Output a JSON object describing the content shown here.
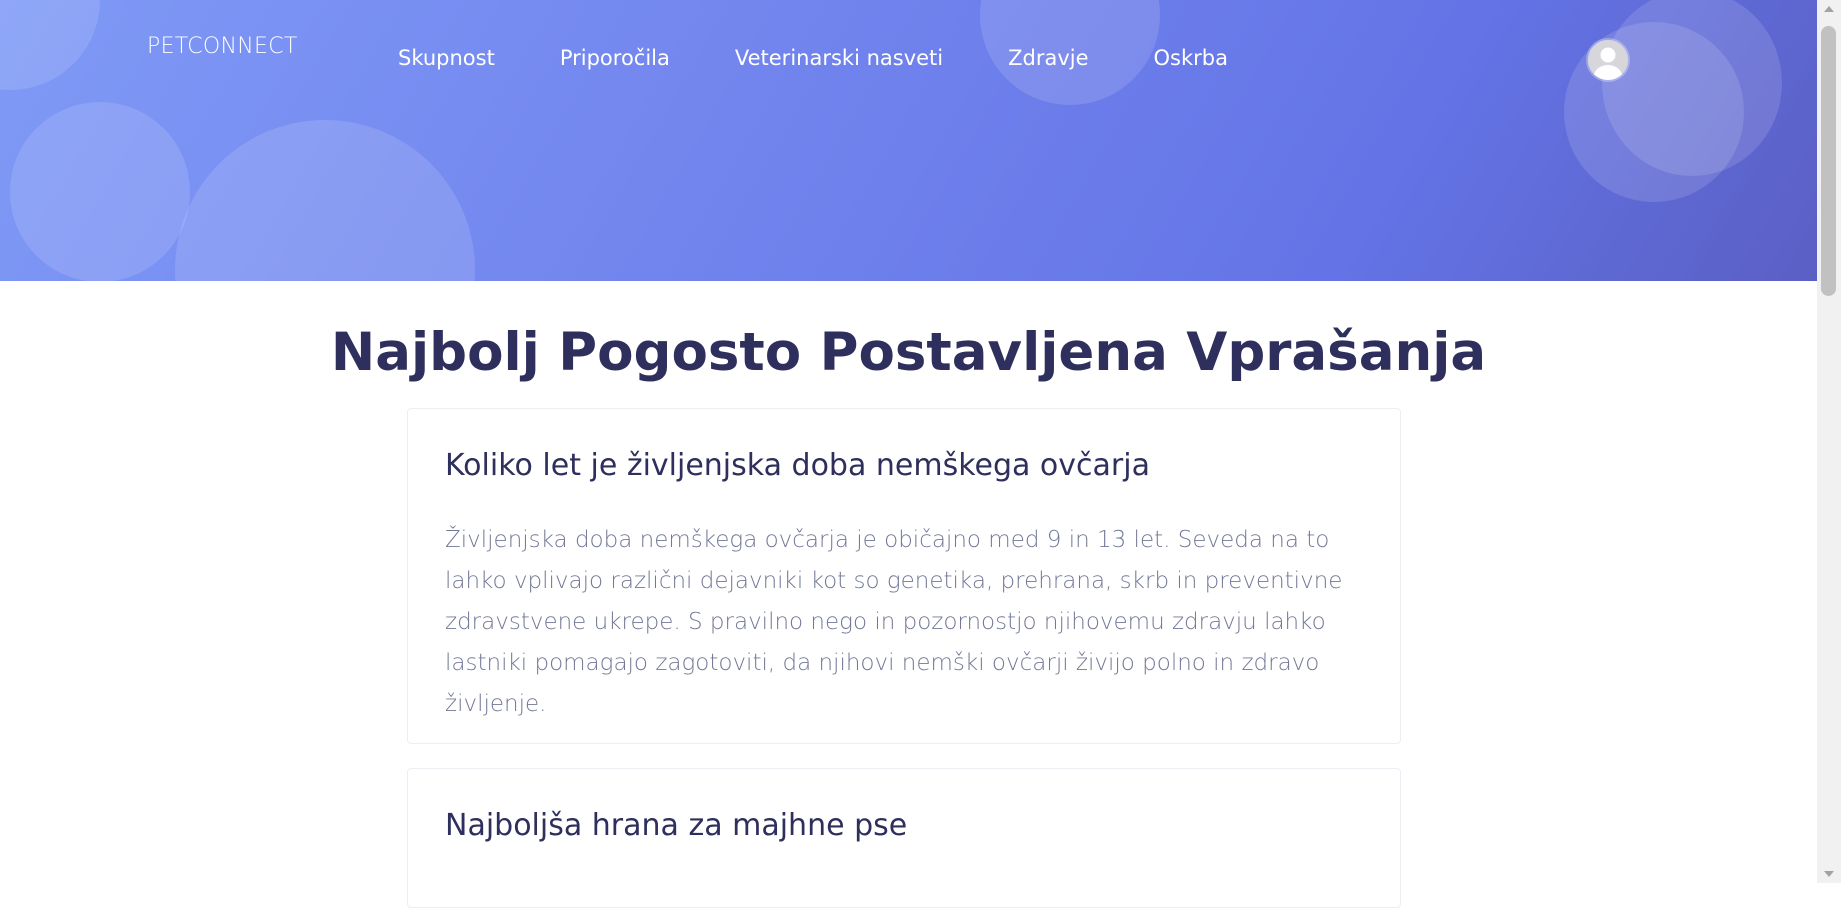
{
  "header": {
    "brand": "PETCONNECT",
    "nav": [
      {
        "label": "Skupnost"
      },
      {
        "label": "Priporočila"
      },
      {
        "label": "Veterinarski nasveti"
      },
      {
        "label": "Zdravje"
      },
      {
        "label": "Oskrba"
      }
    ],
    "avatar_icon": "user-avatar-icon"
  },
  "main": {
    "title": "Najbolj Pogosto Postavljena Vprašanja",
    "faqs": [
      {
        "question": "Koliko let je življenjska doba nemškega ovčarja",
        "answer": "Življenjska doba nemškega ovčarja je običajno med 9 in 13 let. Seveda na to lahko vplivajo različni dejavniki kot so genetika, prehrana, skrb in preventivne zdravstvene ukrepe. S pravilno nego in pozornostjo njihovemu zdravju lahko lastniki pomagajo zagotoviti, da njihovi nemški ovčarji živijo polno in zdravo življenje."
      },
      {
        "question": "Najboljša hrana za majhne pse",
        "answer": ""
      }
    ]
  },
  "colors": {
    "hero_start": "#7f9af6",
    "hero_end": "#5a5fc4",
    "heading": "#2e2f5c",
    "body_text": "#737896"
  }
}
